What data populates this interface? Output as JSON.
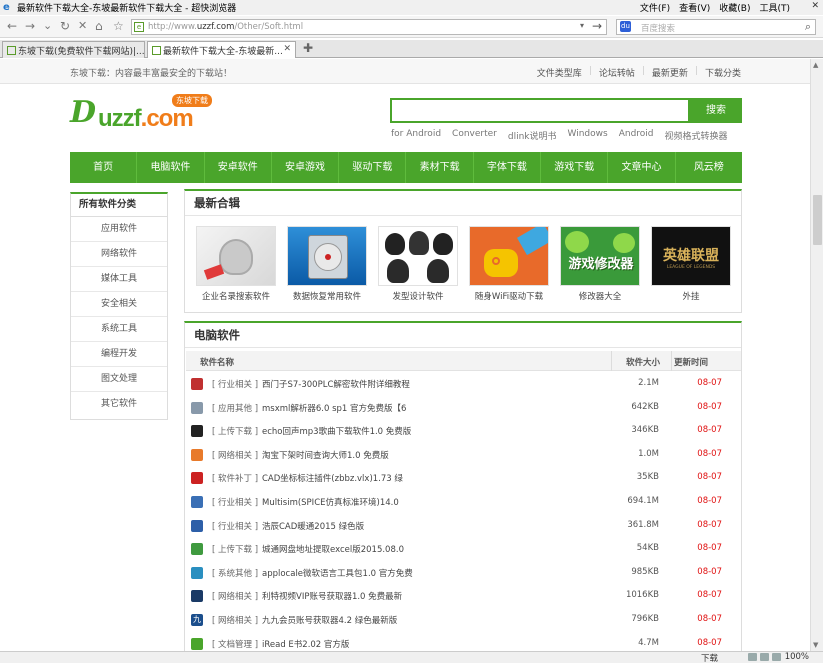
{
  "window": {
    "title": "最新软件下载大全-东坡最新软件下载大全 - 超快浏览器",
    "menus": [
      "文件(F)",
      "查看(V)",
      "收藏(B)",
      "工具(T)"
    ]
  },
  "addressbar": {
    "url_prefix": "http://www.",
    "url_domain": "uzzf.com",
    "url_path": "/Other/Soft.html"
  },
  "searchbar": {
    "placeholder": "百度搜索"
  },
  "tabs": [
    {
      "label": "东坡下载(免费软件下载网站)|...",
      "active": false
    },
    {
      "label": "最新软件下载大全-东坡最新...",
      "active": true
    }
  ],
  "site": {
    "announcement": "东坡下载：内容最丰富最安全的下载站！",
    "toplinks": [
      "文件类型库",
      "论坛转帖",
      "最新更新",
      "下载分类"
    ],
    "logo": {
      "main_a": "uzzf",
      "main_b": ".com",
      "badge": "东坡下载"
    },
    "search_button": "搜索",
    "hot_links": [
      "for Android",
      "Converter",
      "dlink说明书",
      "Windows",
      "Android",
      "视频格式转换器"
    ],
    "nav": [
      "首页",
      "电脑软件",
      "安卓软件",
      "安卓游戏",
      "驱动下载",
      "素材下载",
      "字体下载",
      "游戏下载",
      "文章中心",
      "风云榜"
    ]
  },
  "sidebar": {
    "title": "所有软件分类",
    "items": [
      "应用软件",
      "网络软件",
      "媒体工具",
      "安全相关",
      "系统工具",
      "编程开发",
      "图文处理",
      "其它软件"
    ]
  },
  "albums": {
    "title": "最新合辑",
    "items": [
      {
        "caption": "企业名录搜索软件",
        "thumb": "hand-icon"
      },
      {
        "caption": "数据恢复常用软件",
        "thumb": "harddisk-icon"
      },
      {
        "caption": "发型设计软件",
        "thumb": "hairstyle-icon"
      },
      {
        "caption": "随身WiFi驱动下载",
        "thumb": "wifi-usb-icon"
      },
      {
        "caption": "修改器大全",
        "thumb": "game-modifier-icon",
        "overlay": "游戏修改器"
      },
      {
        "caption": "外挂",
        "thumb": "lol-icon",
        "overlay": "英雄联盟",
        "overlay_sub": "LEAGUE OF LEGENDS"
      }
    ]
  },
  "software": {
    "title": "电脑软件",
    "headers": {
      "name": "软件名称",
      "size": "软件大小",
      "date": "更新时间"
    },
    "rows": [
      {
        "cat": "[ 行业相关 ]",
        "name": "西门子S7-300PLC解密软件附详细教程",
        "size": "2.1M",
        "date": "08-07",
        "icon": "plc-icon",
        "color": "#c03030"
      },
      {
        "cat": "[ 应用其他 ]",
        "name": "msxml解析器6.0 sp1 官方免费版【6",
        "size": "642KB",
        "date": "08-07",
        "icon": "installer-icon",
        "color": "#8899aa"
      },
      {
        "cat": "[ 上传下载 ]",
        "name": "echo回声mp3歌曲下载软件1.0 免费版",
        "size": "346KB",
        "date": "08-07",
        "icon": "echo-icon",
        "color": "#222222"
      },
      {
        "cat": "[ 网络相关 ]",
        "name": "淘宝下架时间查询大师1.0 免费版",
        "size": "1.0M",
        "date": "08-07",
        "icon": "taobao-icon",
        "color": "#e87a2a"
      },
      {
        "cat": "[ 软件补丁 ]",
        "name": "CAD坐标标注插件(zbbz.vlx)1.73 绿",
        "size": "35KB",
        "date": "08-07",
        "icon": "cad-icon",
        "color": "#cc2222"
      },
      {
        "cat": "[ 行业相关 ]",
        "name": "Multisim(SPICE仿真标准环境)14.0",
        "size": "694.1M",
        "date": "08-07",
        "icon": "multisim-icon",
        "color": "#3a6fb5"
      },
      {
        "cat": "[ 行业相关 ]",
        "name": "浩辰CAD暖通2015 绿色版",
        "size": "361.8M",
        "date": "08-07",
        "icon": "gstarcad-icon",
        "color": "#2d5fa8"
      },
      {
        "cat": "[ 上传下载 ]",
        "name": "城通网盘地址提取excel版2015.08.0",
        "size": "54KB",
        "date": "08-07",
        "icon": "excel-icon",
        "color": "#3f9a3f"
      },
      {
        "cat": "[ 系统其他 ]",
        "name": "applocale微软语言工具包1.0 官方免费",
        "size": "985KB",
        "date": "08-07",
        "icon": "applocale-icon",
        "color": "#2a8fc0"
      },
      {
        "cat": "[ 网络相关 ]",
        "name": "利特视频VIP账号获取器1.0 免费最新",
        "size": "1016KB",
        "date": "08-07",
        "icon": "video-icon",
        "color": "#1a3a66"
      },
      {
        "cat": "[ 网络相关 ]",
        "name": "九九会员账号获取器4.2 绿色最新版",
        "size": "796KB",
        "date": "08-07",
        "icon": "nine-icon",
        "color": "#1b4e8c",
        "glyph": "九"
      },
      {
        "cat": "[ 文档管理 ]",
        "name": "iRead E书2.02 官方版",
        "size": "4.7M",
        "date": "08-07",
        "icon": "iread-icon",
        "color": "#4aa52b"
      }
    ]
  },
  "statusbar": {
    "download": "下载",
    "zoom": "100%"
  }
}
